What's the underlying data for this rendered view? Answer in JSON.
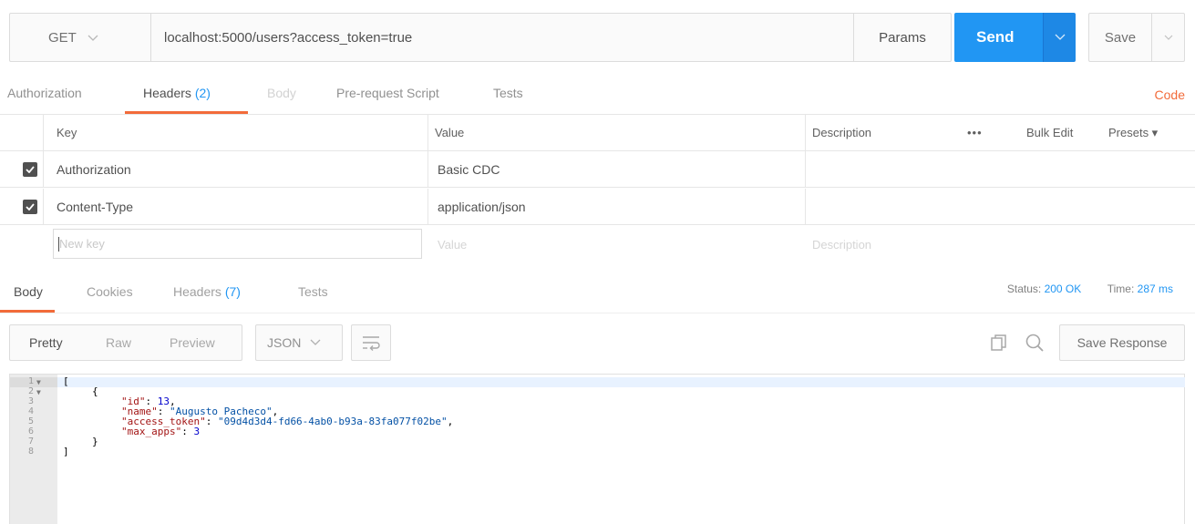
{
  "request": {
    "method": "GET",
    "url": "localhost:5000/users?access_token=true",
    "params_label": "Params",
    "send_label": "Send",
    "save_label": "Save"
  },
  "request_tabs": {
    "authorization": "Authorization",
    "headers": "Headers",
    "headers_count": "(2)",
    "body": "Body",
    "prerequest": "Pre-request Script",
    "tests": "Tests",
    "code": "Code"
  },
  "headers_table": {
    "columns": {
      "key": "Key",
      "value": "Value",
      "description": "Description"
    },
    "more": "•••",
    "bulk_edit": "Bulk Edit",
    "presets": "Presets ▾",
    "rows": [
      {
        "key": "Authorization",
        "value": "Basic CDC",
        "description": "",
        "checked": true
      },
      {
        "key": "Content-Type",
        "value": "application/json",
        "description": "",
        "checked": true
      }
    ],
    "new_row": {
      "key_placeholder": "New key",
      "value_placeholder": "Value",
      "description_placeholder": "Description"
    }
  },
  "response_tabs": {
    "body": "Body",
    "cookies": "Cookies",
    "headers": "Headers",
    "headers_count": "(7)",
    "tests": "Tests",
    "status_label": "Status:",
    "status_value": "200 OK",
    "time_label": "Time:",
    "time_value": "287 ms"
  },
  "response_toolbar": {
    "pretty": "Pretty",
    "raw": "Raw",
    "preview": "Preview",
    "format": "JSON",
    "save_response": "Save Response"
  },
  "response_body": {
    "line_numbers": [
      "1",
      "2",
      "3",
      "4",
      "5",
      "6",
      "7",
      "8"
    ],
    "open_bracket": "[",
    "open_brace": "{",
    "fields": [
      {
        "key": "\"id\"",
        "value": "13",
        "type": "number"
      },
      {
        "key": "\"name\"",
        "value": "\"Augusto Pacheco\"",
        "type": "string"
      },
      {
        "key": "\"access_token\"",
        "value": "\"09d4d3d4-fd66-4ab0-b93a-83fa077f02be\"",
        "type": "string"
      },
      {
        "key": "\"max_apps\"",
        "value": "3",
        "type": "number"
      }
    ],
    "close_brace": "}",
    "close_bracket": "]"
  },
  "colors": {
    "accent_orange": "#f26b3a",
    "send_blue": "#2196f3",
    "count_blue": "#2196f3"
  }
}
